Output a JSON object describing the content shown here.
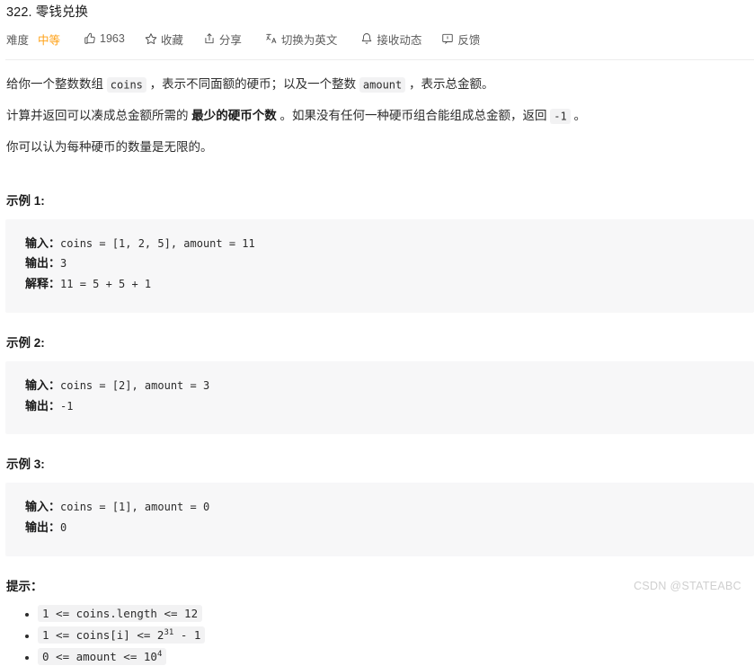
{
  "problem": {
    "title": "322. 零钱兑换",
    "difficulty_label": "难度",
    "difficulty_value": "中等"
  },
  "toolbar": {
    "items": [
      {
        "icon": "thumbs-up-icon",
        "label": "1963"
      },
      {
        "icon": "star-icon",
        "label": "收藏"
      },
      {
        "icon": "share-icon",
        "label": "分享"
      },
      {
        "icon": "translate-icon",
        "label": "切换为英文"
      },
      {
        "icon": "bell-icon",
        "label": "接收动态"
      },
      {
        "icon": "feedback-icon",
        "label": "反馈"
      }
    ]
  },
  "description": {
    "para1": {
      "seg1": "给你一个整数数组 ",
      "code1": "coins",
      "seg2": " ，表示不同面额的硬币；以及一个整数 ",
      "code2": "amount",
      "seg3": " ，表示总金额。"
    },
    "para2": {
      "seg1": "计算并返回可以凑成总金额所需的 ",
      "bold1": "最少的硬币个数",
      "seg2": " 。如果没有任何一种硬币组合能组成总金额，返回 ",
      "code1": "-1",
      "seg3": " 。"
    },
    "para3": "你可以认为每种硬币的数量是无限的。"
  },
  "examples": [
    {
      "heading": "示例 1:",
      "input_label": "输入：",
      "input_value": "coins = [1, 2, 5], amount = 11",
      "output_label": "输出：",
      "output_value": "3",
      "explain_label": "解释：",
      "explain_value": "11 = 5 + 5 + 1"
    },
    {
      "heading": "示例 2:",
      "input_label": "输入：",
      "input_value": "coins = [2], amount = 3",
      "output_label": "输出：",
      "output_value": "-1",
      "explain_label": "",
      "explain_value": ""
    },
    {
      "heading": "示例 3:",
      "input_label": "输入：",
      "input_value": "coins = [1], amount = 0",
      "output_label": "输出：",
      "output_value": "0",
      "explain_label": "",
      "explain_value": ""
    }
  ],
  "hints": {
    "heading": "提示：",
    "items": [
      {
        "base": "1 <= coins.length <= 12",
        "sup": "",
        "tail": ""
      },
      {
        "base": "1 <= coins[i] <= 2",
        "sup": "31",
        "tail": " - 1"
      },
      {
        "base": "0 <= amount <= 10",
        "sup": "4",
        "tail": ""
      }
    ]
  },
  "watermark": "CSDN @STATEABC"
}
